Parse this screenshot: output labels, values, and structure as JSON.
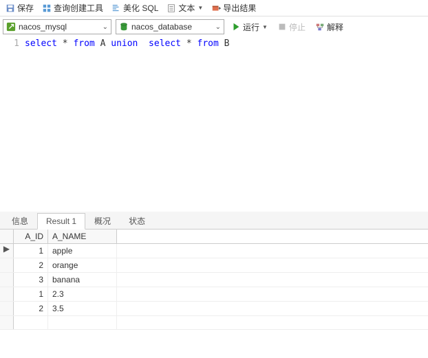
{
  "toolbar1": {
    "save": "保存",
    "query_tool": "查询创建工具",
    "beautify": "美化 SQL",
    "text": "文本",
    "export": "导出结果"
  },
  "toolbar2": {
    "connection": "nacos_mysql",
    "database": "nacos_database",
    "run": "运行",
    "stop": "停止",
    "explain": "解释"
  },
  "editor": {
    "line_no": "1",
    "tokens": [
      {
        "t": "select",
        "c": "kw"
      },
      {
        "t": " * ",
        "c": "plain"
      },
      {
        "t": "from",
        "c": "kw"
      },
      {
        "t": " A ",
        "c": "plain"
      },
      {
        "t": "union",
        "c": "kw"
      },
      {
        "t": "  ",
        "c": "plain"
      },
      {
        "t": "select",
        "c": "kw"
      },
      {
        "t": " * ",
        "c": "plain"
      },
      {
        "t": "from",
        "c": "kw"
      },
      {
        "t": " B",
        "c": "plain"
      }
    ]
  },
  "tabs": {
    "info": "信息",
    "result": "Result 1",
    "profile": "概况",
    "status": "状态"
  },
  "grid": {
    "columns": [
      "A_ID",
      "A_NAME"
    ],
    "rows": [
      {
        "id": "1",
        "name": "apple",
        "pointer": true
      },
      {
        "id": "2",
        "name": "orange",
        "pointer": false
      },
      {
        "id": "3",
        "name": "banana",
        "pointer": false
      },
      {
        "id": "1",
        "name": "2.3",
        "pointer": false
      },
      {
        "id": "2",
        "name": "3.5",
        "pointer": false
      }
    ]
  },
  "colors": {
    "keyword": "#0000ff",
    "conn_green": "#5aa02c",
    "db_green": "#3a9a3a",
    "run_green": "#2e9e2e",
    "stop_gray": "#bbbbbb"
  }
}
